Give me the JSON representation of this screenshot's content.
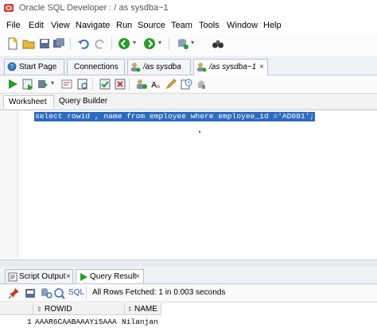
{
  "window": {
    "title": "Oracle SQL Developer : / as sysdba~1"
  },
  "menu": [
    "File",
    "Edit",
    "View",
    "Navigate",
    "Run",
    "Source",
    "Team",
    "Tools",
    "Window",
    "Help"
  ],
  "doc_tabs": [
    {
      "label": "Start Page",
      "icon": "help-circle-icon"
    },
    {
      "label": "Connections",
      "icon": "none"
    },
    {
      "label": "/as sysdba",
      "icon": "db-user-icon"
    },
    {
      "label": "/as sysdba~1",
      "icon": "db-user-icon",
      "active": true
    }
  ],
  "worksheet_tabs": [
    "Worksheet",
    "Query Builder"
  ],
  "editor": {
    "sql": "select rowid , name from employee where employee_id ='AD001';"
  },
  "output_tabs": [
    {
      "label": "Script Output",
      "close": "×"
    },
    {
      "label": "Query Result",
      "close": "×",
      "active": true
    }
  ],
  "results": {
    "sql_label": "SQL",
    "status": "All Rows Fetched: 1 in 0.003 seconds",
    "columns": [
      "ROWID",
      "NAME"
    ],
    "rows": [
      {
        "num": "1",
        "rowid": "AAAR6CAABAAAYi5AAA",
        "name": "Nilanjan"
      }
    ]
  },
  "colors": {
    "selection": "#2d6bbf",
    "accent_green": "#2a9a2a",
    "toolbar_red": "#c43a2f"
  }
}
